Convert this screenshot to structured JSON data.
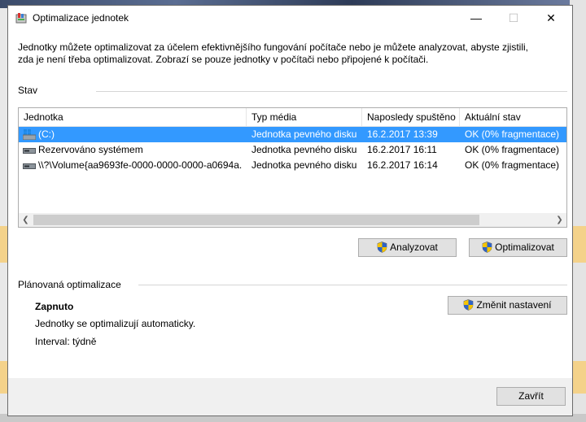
{
  "window": {
    "title": "Optimalizace jednotek",
    "minimize_glyph": "—",
    "maximize_glyph": "☐",
    "close_glyph": "✕"
  },
  "intro": {
    "line1": "Jednotky můžete optimalizovat za účelem efektivnějšího fungování počítače nebo je můžete analyzovat, abyste zjistili,",
    "line2": "zda je není třeba optimalizovat. Zobrazí se pouze jednotky v počítači nebo připojené k počítači."
  },
  "status_section": {
    "label": "Stav"
  },
  "drive_list": {
    "columns": [
      "Jednotka",
      "Typ média",
      "Naposledy spuštěno",
      "Aktuální stav"
    ],
    "rows": [
      {
        "name": "(C:)",
        "media": "Jednotka pevného disku",
        "last_run": "16.2.2017 13:39",
        "status": "OK (0% fragmentace)",
        "icon": "windows-drive-icon",
        "selected": true
      },
      {
        "name": "Rezervováno systémem",
        "media": "Jednotka pevného disku",
        "last_run": "16.2.2017 16:11",
        "status": "OK (0% fragmentace)",
        "icon": "hard-drive-icon",
        "selected": false
      },
      {
        "name": "\\\\?\\Volume{aa9693fe-0000-0000-0000-a0694a...",
        "media": "Jednotka pevného disku",
        "last_run": "16.2.2017 16:14",
        "status": "OK (0% fragmentace)",
        "icon": "hard-drive-icon",
        "selected": false
      }
    ]
  },
  "buttons": {
    "analyze": "Analyzovat",
    "optimize": "Optimalizovat",
    "change_settings": "Změnit nastavení",
    "close": "Zavřít"
  },
  "scheduled": {
    "label": "Plánovaná optimalizace",
    "state": "Zapnuto",
    "description": "Jednotky se optimalizují automaticky.",
    "interval": "Interval: týdně"
  },
  "colors": {
    "selection": "#3399ff",
    "button_face": "#e1e1e1",
    "button_border": "#adadad"
  }
}
